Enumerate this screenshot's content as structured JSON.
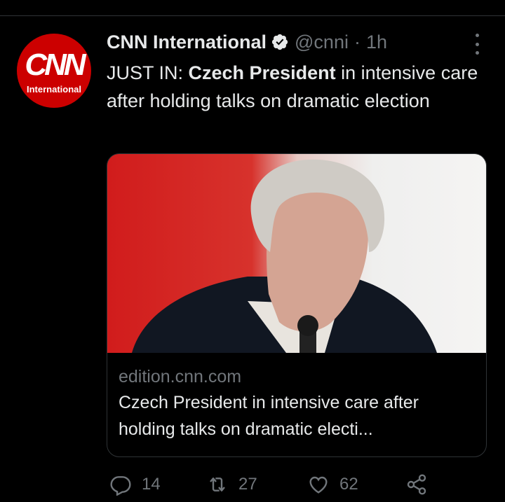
{
  "tweet": {
    "avatar_logo": "CNN",
    "avatar_sub": "International",
    "display_name": "CNN International",
    "handle": "@cnni",
    "separator": "·",
    "time": "1h",
    "text_prefix": "JUST IN: ",
    "text_bold": "Czech President",
    "text_rest": " in intensive care after holding talks on dramatic election"
  },
  "card": {
    "domain": "edition.cnn.com",
    "title": "Czech President in intensive care after holding talks on dramatic electi..."
  },
  "actions": {
    "reply_count": "14",
    "retweet_count": "27",
    "like_count": "62"
  },
  "icons": {
    "verified": "verified-badge-icon",
    "more": "more-dots-icon",
    "reply": "reply-icon",
    "retweet": "retweet-icon",
    "like": "heart-icon",
    "share": "share-icon"
  },
  "colors": {
    "background": "#000000",
    "text": "#e7e9ea",
    "secondary": "#71767b",
    "cnn_red": "#cc0000"
  }
}
